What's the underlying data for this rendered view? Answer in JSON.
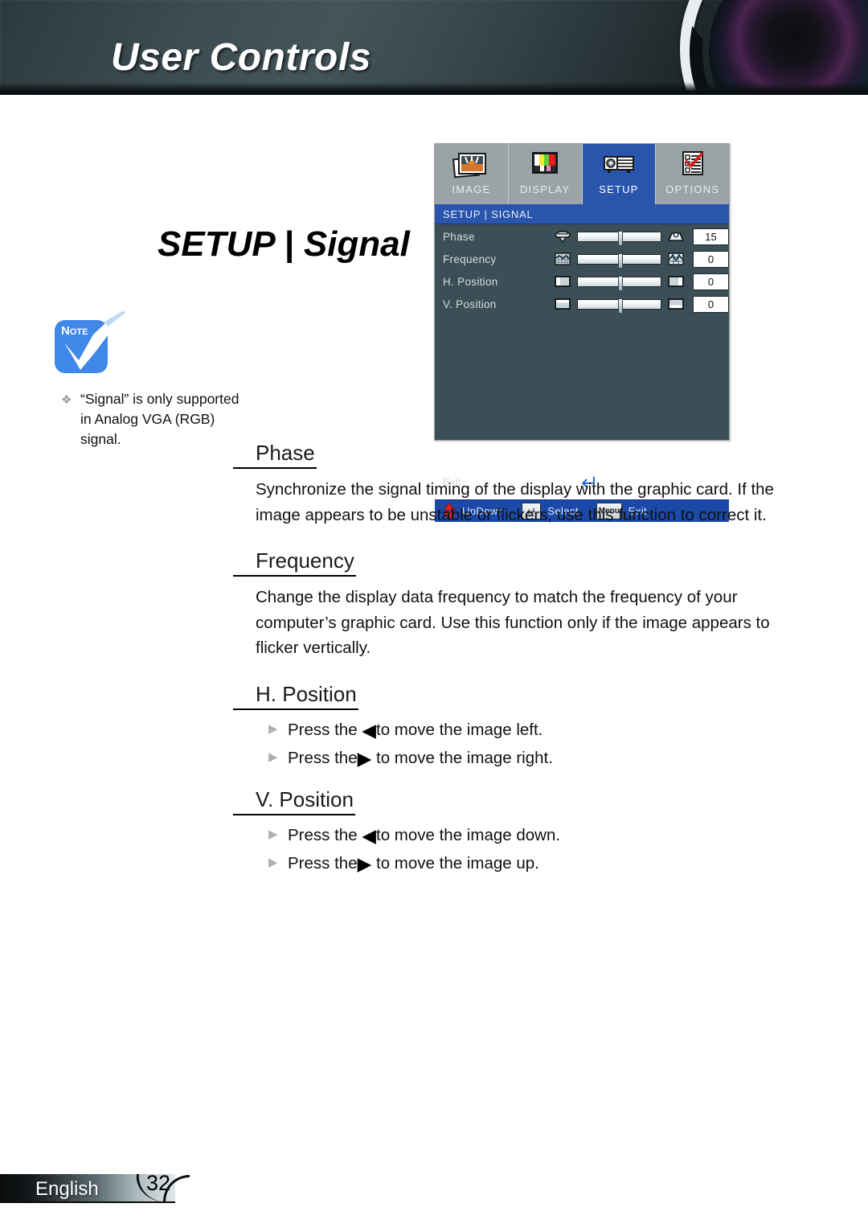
{
  "header": {
    "title": "User Controls",
    "lens_icon": "camera-lens-icon"
  },
  "page_title": "SETUP | Signal",
  "note": {
    "icon_word_first": "N",
    "icon_word_rest": "OTE",
    "bullet": "❖",
    "text": "“Signal” is only supported in Analog VGA (RGB) signal."
  },
  "osd": {
    "tabs": [
      {
        "label": "IMAGE",
        "icon": "image-photo-icon",
        "active": false
      },
      {
        "label": "DISPLAY",
        "icon": "color-bars-icon",
        "active": false
      },
      {
        "label": "SETUP",
        "icon": "projector-icon",
        "active": true
      },
      {
        "label": "OPTIONS",
        "icon": "checklist-icon",
        "active": false
      }
    ],
    "titlebar": "SETUP | SIGNAL",
    "rows": [
      {
        "label": "Phase",
        "value": "15",
        "left_icon": "phase-narrow-icon",
        "right_icon": "phase-wide-icon",
        "thumb_percent": 50
      },
      {
        "label": "Frequency",
        "value": "0",
        "left_icon": "frequency-fine-icon",
        "right_icon": "frequency-coarse-icon",
        "thumb_percent": 50
      },
      {
        "label": "H. Position",
        "value": "0",
        "left_icon": "h-position-left-icon",
        "right_icon": "h-position-right-icon",
        "thumb_percent": 50
      },
      {
        "label": "V. Position",
        "value": "0",
        "left_icon": "v-position-top-icon",
        "right_icon": "v-position-bottom-icon",
        "thumb_percent": 50
      }
    ],
    "exit_label": "Exit",
    "enter_glyph": "↵",
    "footer": {
      "updown_label": "UpDown",
      "select_label": "Select",
      "select_key": "↵",
      "exit_label": "Exit",
      "menu_key": "Menu"
    },
    "colors": {
      "accent_blue": "#2a55ad",
      "footer_blue": "#1a49a8",
      "panel_bg": "#3c4f57",
      "tab_bg": "#9aa3a6"
    }
  },
  "sections": [
    {
      "heading": "Phase",
      "body": "Synchronize the signal timing of the display with the graphic card. If the image appears to be unstable or flickers, use this function to correct it.",
      "bullets": []
    },
    {
      "heading": "Frequency",
      "body": "Change the display data frequency to match the frequency of your computer’s graphic card. Use this function only if the image appears to flicker vertically.",
      "bullets": []
    },
    {
      "heading": "H. Position",
      "body": "",
      "bullets": [
        {
          "pre": "Press the ",
          "arrow": "◀",
          "post": "to move the image left."
        },
        {
          "pre": "Press the",
          "arrow": "▶",
          "post": " to move the image right."
        }
      ]
    },
    {
      "heading": "V. Position",
      "body": "",
      "bullets": [
        {
          "pre": "Press the ",
          "arrow": "◀",
          "post": "to move the image down."
        },
        {
          "pre": "Press the",
          "arrow": "▶",
          "post": " to move the image up."
        }
      ]
    }
  ],
  "footer": {
    "language": "English",
    "page_number": "32"
  }
}
